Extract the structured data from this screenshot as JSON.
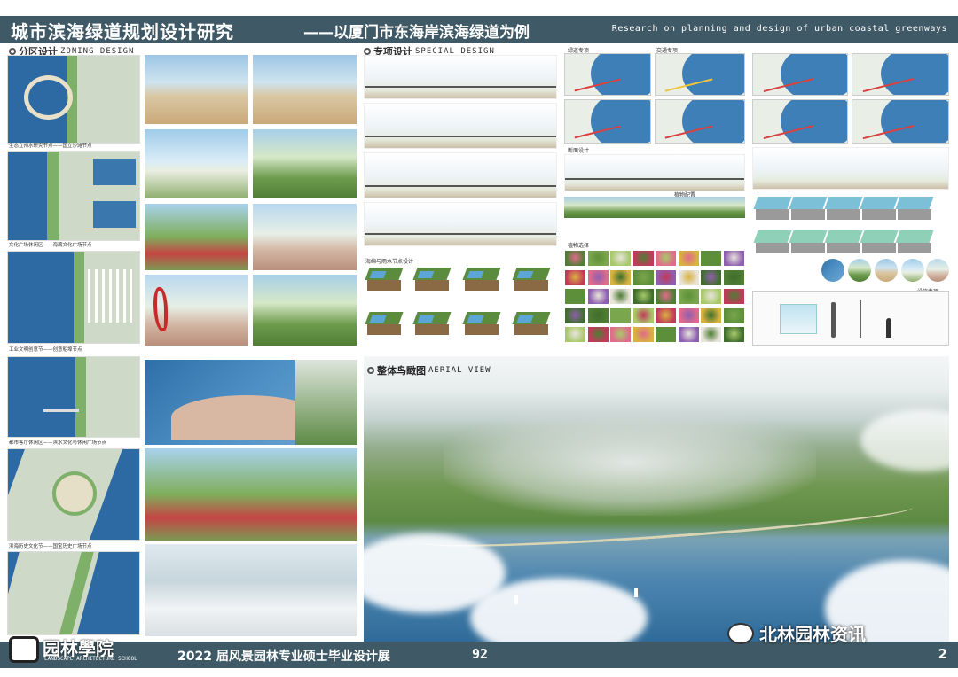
{
  "header": {
    "title": "城市滨海绿道规划设计研究",
    "subtitle": "——以厦门市东海岸滨海绿道为例",
    "title_en": "Research on planning and design of urban coastal greenways"
  },
  "sections": {
    "zoning": {
      "title": "分区设计",
      "title_en": "ZONING DESIGN"
    },
    "special": {
      "title": "专项设计",
      "title_en": "SPECIAL DESIGN"
    },
    "aerial": {
      "title": "整体鸟瞰图",
      "title_en": "AERIAL VIEW"
    }
  },
  "zones": [
    "生态立州水研究节点——国立沙滩节点",
    "文化广场休闲区——海湾文化广场节点",
    "工业文明创意节——创意船埠节点",
    "都市客厅休闲区——滨水文化与休闲广场节点",
    "滨海历史文化节——国宝历史广场节点"
  ],
  "special_labels": {
    "green_space": "绿道专项",
    "traffic": "交通专项",
    "section_design": "断面设计",
    "plant_config": "植物配置",
    "scene_recommend": "植物选择",
    "sponge": "海绵与雨水节点设计",
    "facility": "设施专项"
  },
  "footer": {
    "text": "2022 届风景园林专业硕士毕业设计展",
    "number": "92",
    "page": "2"
  },
  "logo": {
    "name": "园林學院",
    "en": "LANDSCAPE ARCHITECTURE SCHOOL"
  },
  "watermark": "北林园林资讯"
}
